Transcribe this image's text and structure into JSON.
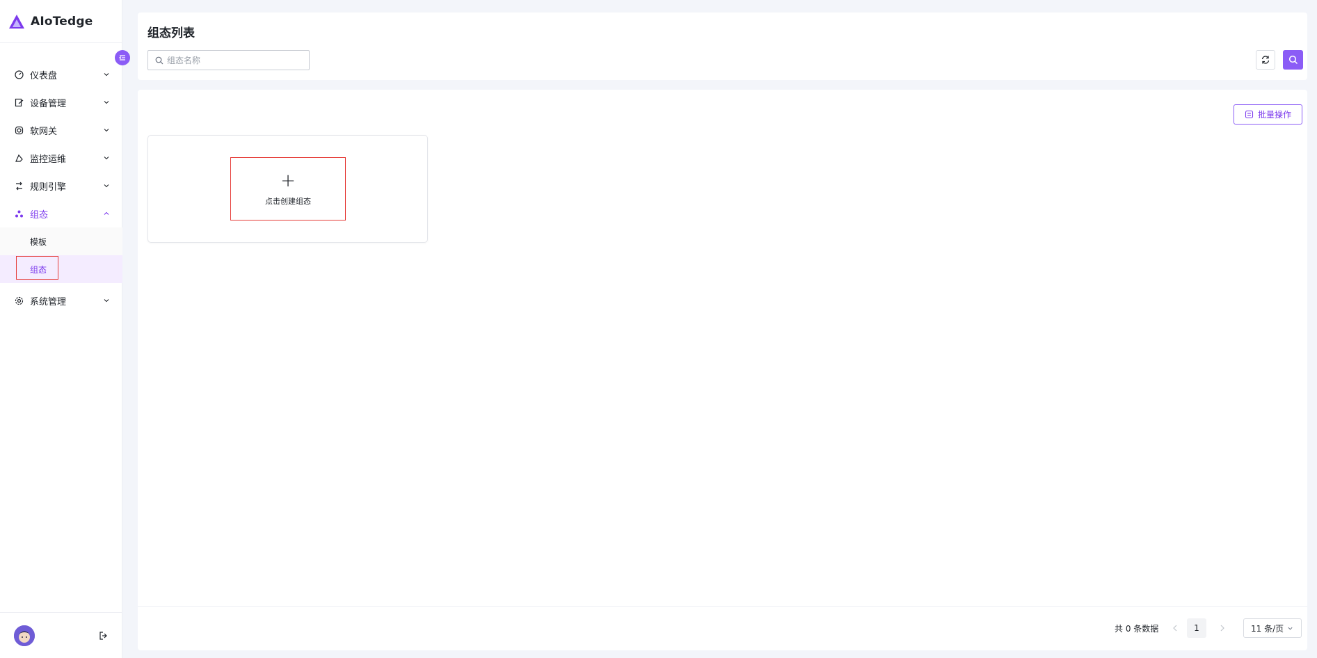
{
  "app": {
    "name": "AIoTedge"
  },
  "sidebar": {
    "items": [
      {
        "label": "仪表盘",
        "icon": "dashboard-icon"
      },
      {
        "label": "设备管理",
        "icon": "device-icon"
      },
      {
        "label": "软网关",
        "icon": "gateway-icon"
      },
      {
        "label": "监控运维",
        "icon": "monitor-icon"
      },
      {
        "label": "规则引擎",
        "icon": "rule-engine-icon"
      },
      {
        "label": "组态",
        "icon": "scada-icon",
        "expanded": true,
        "children": [
          {
            "label": "模板"
          },
          {
            "label": "组态",
            "selected": true
          }
        ]
      },
      {
        "label": "系统管理",
        "icon": "settings-icon"
      }
    ]
  },
  "header": {
    "title": "组态列表",
    "search_placeholder": "组态名称",
    "search_value": ""
  },
  "main": {
    "batch_label": "批量操作",
    "create_label": "点击创建组态",
    "create_symbol": "+"
  },
  "pagination": {
    "total_text": "共 0 条数据",
    "current_page": "1",
    "page_size_label": "11 条/页"
  },
  "colors": {
    "accent": "#8b5cf6",
    "highlight": "#e53935"
  }
}
